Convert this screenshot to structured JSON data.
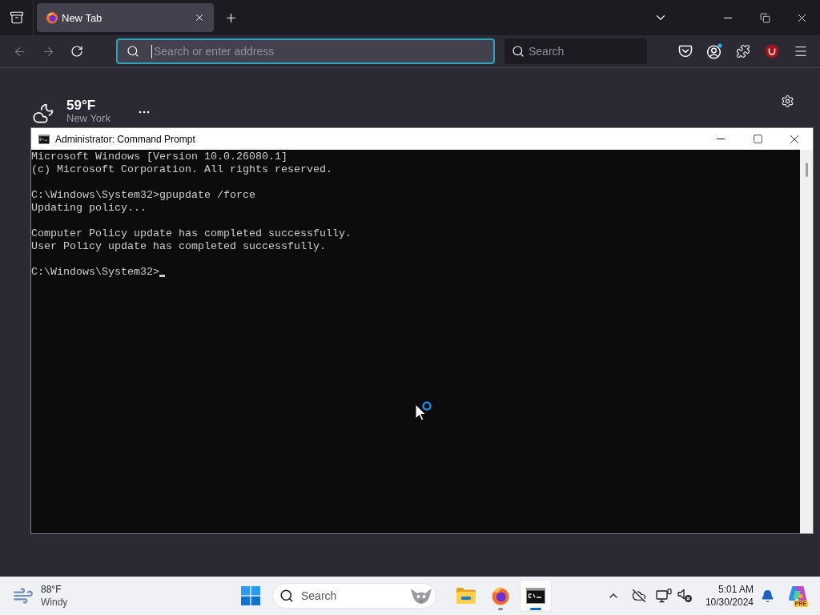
{
  "browser": {
    "tabs": [
      {
        "label": "New Tab",
        "selected": true
      }
    ],
    "back": {
      "disabled": true
    },
    "forward": {
      "disabled": true
    },
    "address_bar": {
      "placeholder": "Search or enter address",
      "focused": true
    },
    "search_bar": {
      "placeholder": "Search"
    },
    "weather": {
      "temperature": "59°F",
      "location": "New York"
    }
  },
  "console_window": {
    "title": "Administrator: Command Prompt",
    "output": [
      [
        "Microsoft Windows [Version 10.0.26080.1]",
        "(c) Microsoft Corporation. All rights reserved."
      ],
      [
        "C:\\Windows\\System32>gpupdate /force",
        "Updating policy..."
      ],
      [
        "Computer Policy update has completed successfully.",
        "User Policy update has completed successfully."
      ]
    ],
    "prompt": "C:\\Windows\\System32>",
    "cursor": true
  },
  "taskbar": {
    "weather": {
      "temperature": "88°F",
      "condition": "Windy"
    },
    "search": {
      "placeholder": "Search"
    },
    "apps": [
      {
        "kind": "folder",
        "running": false,
        "selected": false
      },
      {
        "kind": "browser",
        "running": true,
        "selected": false
      },
      {
        "kind": "terminal",
        "running": true,
        "selected": true
      }
    ],
    "clock": {
      "time": "5:01 AM",
      "date": "10/30/2024"
    },
    "assistant_badge": "PRE"
  }
}
